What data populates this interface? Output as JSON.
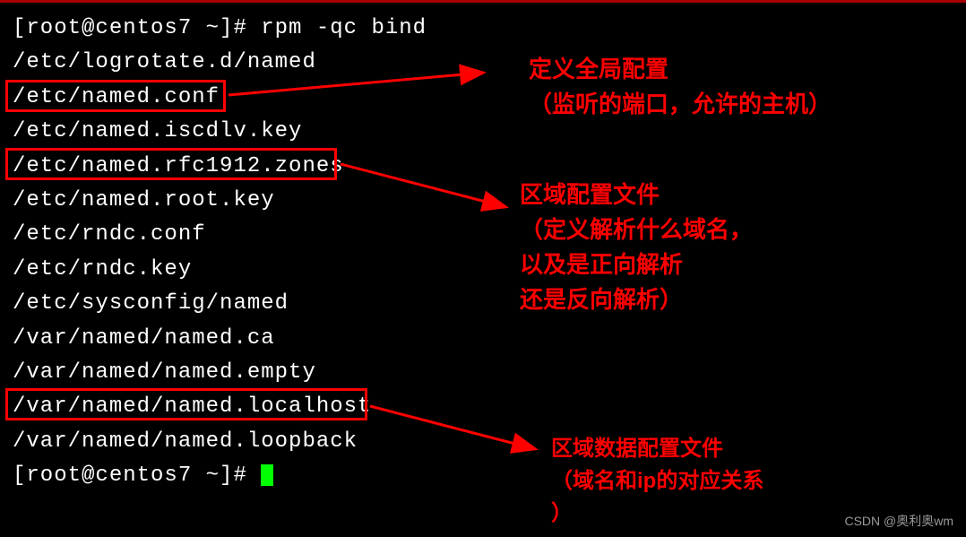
{
  "terminal": {
    "prompt1": "[root@centos7 ~]# rpm -qc bind",
    "lines": [
      "/etc/logrotate.d/named",
      "/etc/named.conf",
      "/etc/named.iscdlv.key",
      "/etc/named.rfc1912.zones",
      "/etc/named.root.key",
      "/etc/rndc.conf",
      "/etc/rndc.key",
      "/etc/sysconfig/named",
      "/var/named/named.ca",
      "/var/named/named.empty",
      "/var/named/named.localhost",
      "/var/named/named.loopback"
    ],
    "prompt2": "[root@centos7 ~]# "
  },
  "annotations": {
    "a1": {
      "line1": "定义全局配置",
      "line2": "（监听的端口，允许的主机）"
    },
    "a2": {
      "line1": "区域配置文件",
      "line2": "（定义解析什么域名，",
      "line3": "以及是正向解析",
      "line4": "还是反向解析）"
    },
    "a3": {
      "line1": "区域数据配置文件",
      "line2": "（域名和ip的对应关系",
      "line3": "）"
    }
  },
  "watermark": "CSDN @奥利奥wm"
}
